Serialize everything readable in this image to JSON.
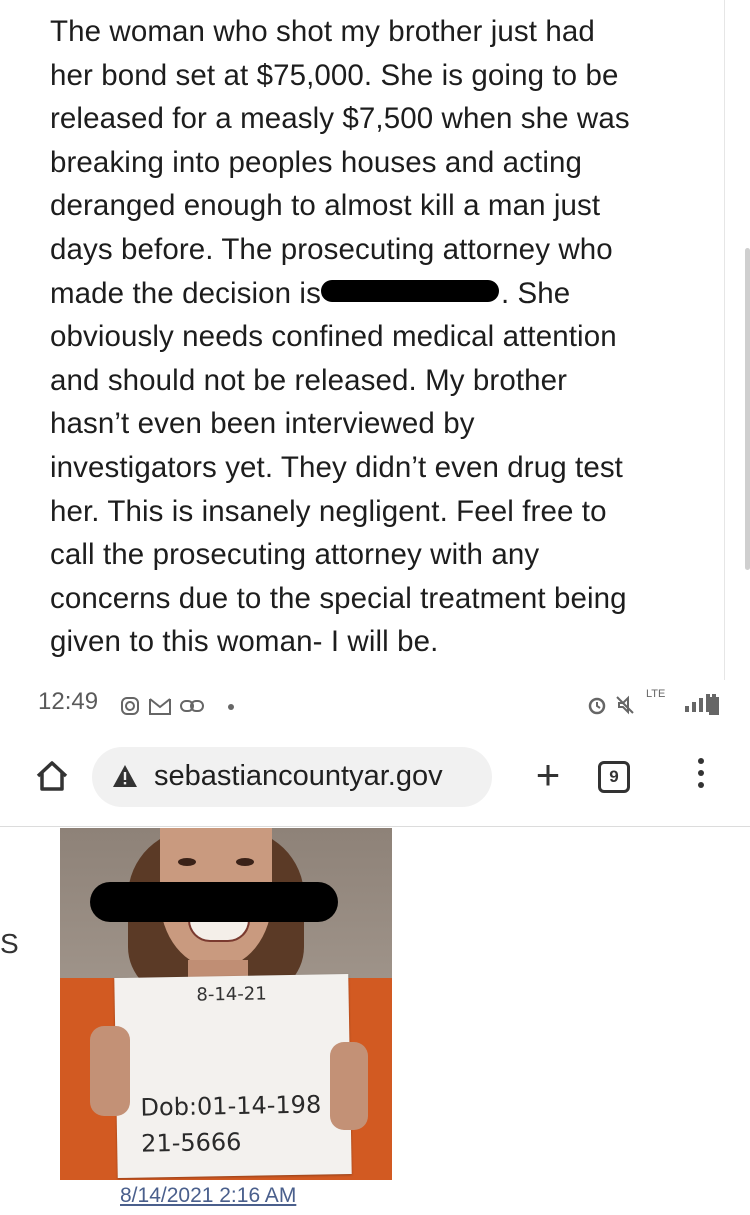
{
  "post": {
    "lines": [
      "The woman who shot my brother just had",
      "her bond set at $75,000. She is going to be",
      "released for a measly $7,500 when she was",
      "breaking into peoples houses and acting",
      "deranged enough to almost kill a man just",
      "days before. The prosecuting attorney who",
      "made the decision is",
      ". She",
      "obviously needs confined medical attention",
      "and should not be released. My brother",
      "hasn’t even been interviewed by",
      "investigators yet. They didn’t even drug test",
      "her. This is insanely negligent. Feel free to",
      "call the prosecuting attorney with any",
      "concerns due to the special treatment being",
      "given to this woman- I will be."
    ]
  },
  "statusbar": {
    "time": "12:49",
    "network_label": "LTE"
  },
  "browser": {
    "url": "sebastiancountyar.gov",
    "tab_count": "9"
  },
  "page": {
    "left_edge_letter": "S",
    "sign": {
      "date": "8-14-21",
      "dob": "Dob:01-14-198",
      "number": "21-5666"
    },
    "timestamp": "8/14/2021 2:16 AM"
  },
  "colors": {
    "shirt": "#d25a22",
    "link": "#4a5f8c"
  }
}
